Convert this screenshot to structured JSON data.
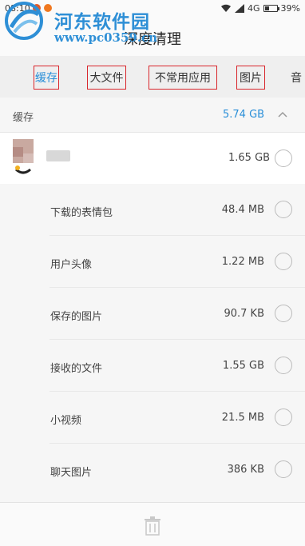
{
  "status_bar": {
    "time": "08:10",
    "network": "4G",
    "battery": "39%",
    "battery_level": 0.39
  },
  "watermark": {
    "text": "河东软件园",
    "url": "www.pc0359.cn"
  },
  "title_bar": {
    "title": "深度清理"
  },
  "tabs": [
    {
      "label": "缓存",
      "active": true
    },
    {
      "label": "大文件",
      "active": false
    },
    {
      "label": "不常用应用",
      "active": false
    },
    {
      "label": "图片",
      "active": false
    },
    {
      "label": "音",
      "active": false
    }
  ],
  "section": {
    "label": "缓存",
    "size": "5.74 GB"
  },
  "app_row": {
    "size": "1.65 GB"
  },
  "items": [
    {
      "label": "下载的表情包",
      "size": "48.4 MB"
    },
    {
      "label": "用户头像",
      "size": "1.22 MB"
    },
    {
      "label": "保存的图片",
      "size": "90.7 KB"
    },
    {
      "label": "接收的文件",
      "size": "1.55 GB"
    },
    {
      "label": "小视频",
      "size": "21.5 MB"
    },
    {
      "label": "聊天图片",
      "size": "386 KB"
    }
  ],
  "colors": {
    "accent": "#2a8fd8",
    "highlight_box": "#d9262c"
  }
}
